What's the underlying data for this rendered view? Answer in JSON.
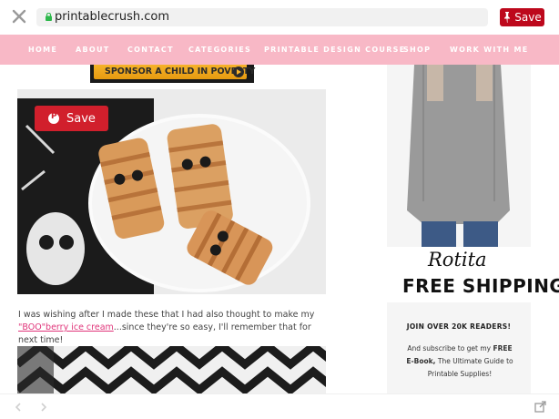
{
  "browser": {
    "url": "printablecrush.com",
    "save_label": "Save"
  },
  "nav": {
    "items": [
      "HOME",
      "ABOUT",
      "CONTACT",
      "CATEGORIES",
      "PRINTABLE DESIGN COURSE",
      "SHOP",
      "WORK WITH ME"
    ]
  },
  "sponsor": {
    "text": "SPONSOR A CHILD IN POVERTY"
  },
  "pin_save": {
    "label": "Save"
  },
  "article": {
    "text_before": "I was wishing after I made these that I had also thought to make my ",
    "link_text": "\"BOO\"berry ice cream",
    "text_after": "...since they're so easy, I'll remember that for next time!"
  },
  "sidebar": {
    "ad_brand": "Rotita",
    "ad_text": "FREE SHIPPING",
    "join_title": "JOIN OVER 20K READERS!",
    "join_text_before": "And subscribe to get my ",
    "join_bold": "FREE E-Book,",
    "join_text_after": " The Ultimate Guide to Printable Supplies!"
  },
  "colors": {
    "nav_bg": "#f8b8c6",
    "pinterest_red": "#bd081c",
    "link": "#e0357a"
  }
}
